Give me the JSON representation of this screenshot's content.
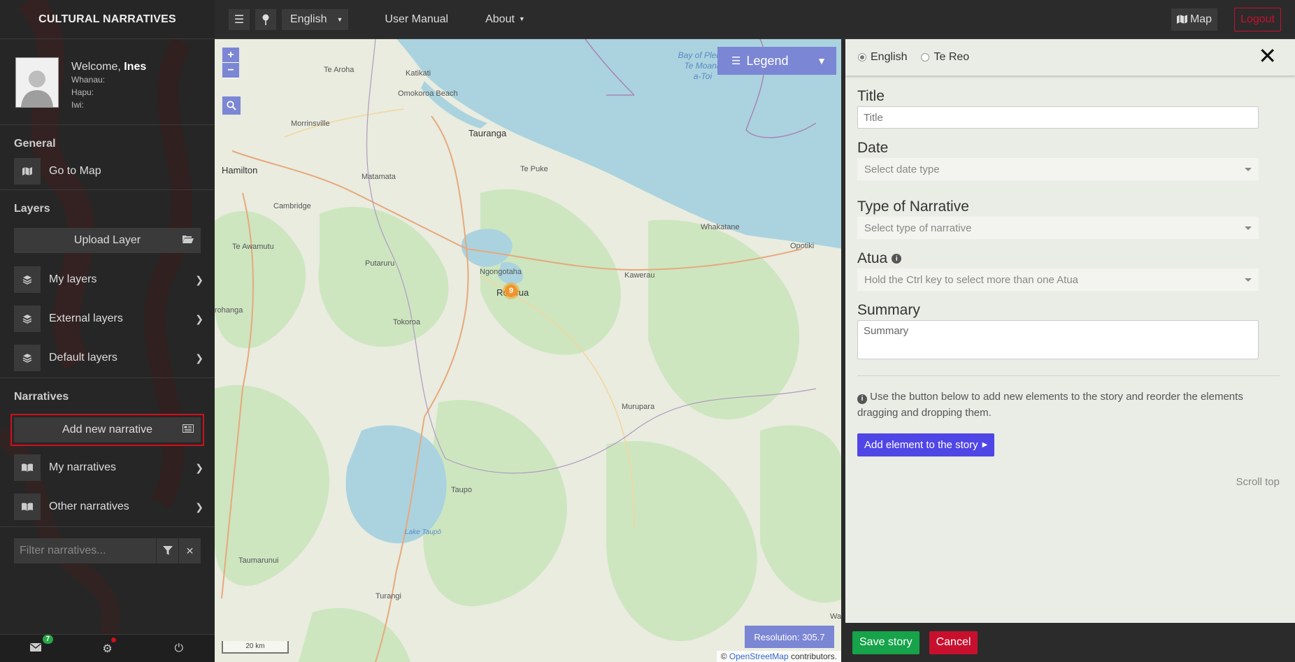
{
  "sidebar": {
    "brand": "CULTURAL NARRATIVES",
    "welcome_prefix": "Welcome,",
    "user_name": "Ines",
    "whanau_label": "Whanau:",
    "hapu_label": "Hapu:",
    "iwi_label": "Iwi:",
    "general": {
      "heading": "General",
      "go_to_map": "Go to Map"
    },
    "layers": {
      "heading": "Layers",
      "upload": "Upload Layer",
      "items": [
        {
          "label": "My layers"
        },
        {
          "label": "External layers"
        },
        {
          "label": "Default layers"
        }
      ]
    },
    "narratives": {
      "heading": "Narratives",
      "add_new": "Add new narrative",
      "items": [
        {
          "label": "My narratives"
        },
        {
          "label": "Other narratives"
        }
      ]
    },
    "filter": {
      "placeholder": "Filter narratives..."
    },
    "footer": {
      "messages_count": "7"
    }
  },
  "topnav": {
    "language": "English",
    "user_manual": "User Manual",
    "about": "About",
    "map": "Map",
    "logout": "Logout"
  },
  "map": {
    "legend": "Legend",
    "cluster_count": "9",
    "scale": "20 km",
    "resolution_label": "Resolution:",
    "resolution_value": "305.7",
    "attribution_prefix": "©",
    "attribution_link": "OpenStreetMap",
    "attribution_suffix": "contributors.",
    "places": [
      "Te Aroha",
      "Katikati",
      "Omokoroa Beach",
      "Tauranga",
      "Morrinsville",
      "Hamilton",
      "Matamata",
      "Te Puke",
      "Cambridge",
      "Whakatane",
      "Opotiki",
      "Te Awamutu",
      "Putaruru",
      "Ngongotaha",
      "Rotorua",
      "Kawerau",
      "Tokoroa",
      "Murupara",
      "rohanga",
      "Taupo",
      "Taumarunui",
      "Turangi",
      "Wai"
    ],
    "water_labels": {
      "bay_line1": "Bay of Plenty",
      "bay_line2": "Te Moana",
      "bay_line3": "a-Toi",
      "lake": "Lake Taupō"
    }
  },
  "panel": {
    "lang_options": [
      {
        "label": "English",
        "selected": true
      },
      {
        "label": "Te Reo",
        "selected": false
      }
    ],
    "title_label": "Title",
    "title_placeholder": "Title",
    "date_label": "Date",
    "date_placeholder": "Select date type",
    "type_label": "Type of Narrative",
    "type_placeholder": "Select type of narrative",
    "atua_label": "Atua",
    "atua_placeholder": "Hold the Ctrl key to select more than one Atua",
    "summary_label": "Summary",
    "summary_placeholder": "Summary",
    "hint": "Use the button below to add new elements to the story and reorder the elements dragging and dropping them.",
    "add_element": "Add element to the story",
    "scroll_top": "Scroll top",
    "save": "Save story",
    "cancel": "Cancel"
  },
  "colors": {
    "accent": "#7b86d4",
    "primary_button": "#4f46e5",
    "save": "#16a34a",
    "danger": "#c8102e"
  }
}
